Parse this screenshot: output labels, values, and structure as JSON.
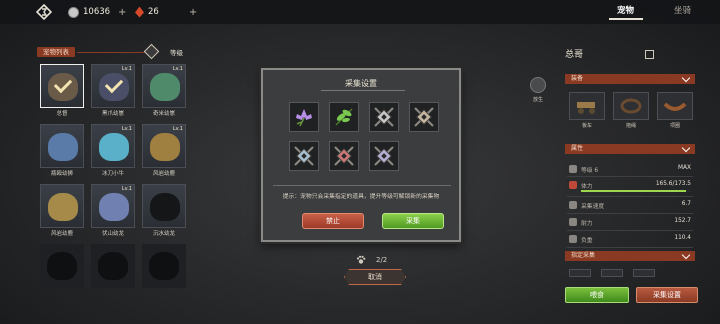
{
  "topbar": {
    "coins": "10636",
    "coin_plus": "+",
    "gems": "26",
    "gem_plus": "+",
    "tabs": [
      {
        "label": "宠物",
        "active": true
      },
      {
        "label": "坐骑",
        "active": false
      }
    ]
  },
  "pet_list": {
    "title": "宠物列表",
    "sort_label": "等级",
    "pets": [
      {
        "name": "总督",
        "level": "",
        "selected": true,
        "checked": true,
        "color": "#6a5a48"
      },
      {
        "name": "黑爪幼崽",
        "level": "Lv.1",
        "selected": false,
        "checked": true,
        "color": "#4a4e66"
      },
      {
        "name": "奇米幼崽",
        "level": "Lv.1",
        "selected": false,
        "checked": false,
        "color": "#4f8a6a"
      },
      {
        "name": "瓶殴幼狮",
        "level": "",
        "selected": false,
        "checked": false,
        "color": "#5a7aa8"
      },
      {
        "name": "冰刀小牛",
        "level": "Lv.1",
        "selected": false,
        "checked": false,
        "color": "#5ab0c8"
      },
      {
        "name": "风岩幼鹿",
        "level": "Lv.1",
        "selected": false,
        "checked": false,
        "color": "#a08040"
      },
      {
        "name": "风岩幼鹿",
        "level": "",
        "selected": false,
        "checked": false,
        "color": "#a58a4a"
      },
      {
        "name": "伏山幼龙",
        "level": "Lv.1",
        "selected": false,
        "checked": false,
        "color": "#7080b0"
      },
      {
        "name": "沉水幼龙",
        "level": "",
        "selected": false,
        "checked": false,
        "color": "#151617"
      }
    ],
    "empty_slots": 3
  },
  "modal": {
    "title": "采集设置",
    "items": [
      {
        "icon": "flower-icon",
        "color": "#b890e8"
      },
      {
        "icon": "herb-icon",
        "color": "#7ac850"
      },
      {
        "icon": "ore-icon",
        "color": "#c8c8c8"
      },
      {
        "icon": "ore-icon",
        "color": "#c8b8a0"
      },
      {
        "icon": "ore-icon",
        "color": "#a8c0d0"
      },
      {
        "icon": "ore-icon",
        "color": "#d07878"
      },
      {
        "icon": "ore-icon",
        "color": "#b8b0d8"
      }
    ],
    "tip": "提示：宠物只会采集指定的道具，提升等级可解锁新的采集物",
    "forbid_label": "禁止",
    "collect_label": "采集"
  },
  "pagination": {
    "text": "2/2"
  },
  "cancel_label": "取消",
  "side_button_label": "放生",
  "detail": {
    "name": "总哥",
    "equipment_header": "装备",
    "equipment": [
      {
        "label": "板车",
        "icon": "cart-icon"
      },
      {
        "label": "拖绳",
        "icon": "rope-icon"
      },
      {
        "label": "项圈",
        "icon": "collar-icon"
      }
    ],
    "attributes_header": "属性",
    "level_label": "等级 6",
    "level_value": "MAX",
    "stats": [
      {
        "name": "体力",
        "value": "165.6/173.5",
        "fill": 0.95
      },
      {
        "name": "采集速度",
        "value": "6.7"
      },
      {
        "name": "耐力",
        "value": "152.7"
      },
      {
        "name": "负重",
        "value": "110.4"
      }
    ],
    "collect_header": "指定采集",
    "feed_label": "喂食",
    "setup_label": "采集设置"
  }
}
